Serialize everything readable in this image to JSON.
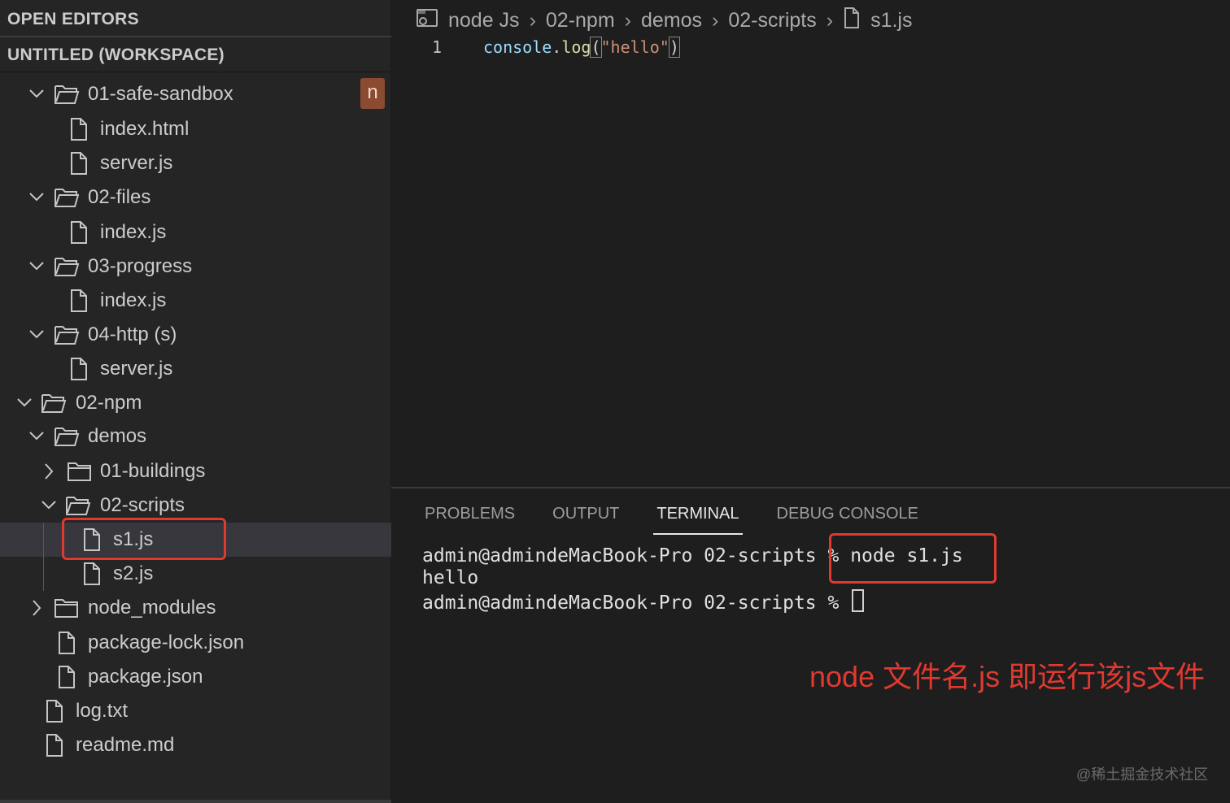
{
  "sidebar": {
    "open_editors_label": "OPEN EDITORS",
    "workspace_label": "UNTITLED (WORKSPACE)",
    "badge": "n",
    "tree": [
      {
        "label": "01-safe-sandbox",
        "kind": "folder",
        "expanded": true
      },
      {
        "label": "index.html",
        "kind": "file"
      },
      {
        "label": "server.js",
        "kind": "file"
      },
      {
        "label": "02-files",
        "kind": "folder",
        "expanded": true
      },
      {
        "label": "index.js",
        "kind": "file"
      },
      {
        "label": "03-progress",
        "kind": "folder",
        "expanded": true
      },
      {
        "label": "index.js",
        "kind": "file"
      },
      {
        "label": "04-http (s)",
        "kind": "folder",
        "expanded": true
      },
      {
        "label": "server.js",
        "kind": "file"
      },
      {
        "label": "02-npm",
        "kind": "folder",
        "expanded": true
      },
      {
        "label": "demos",
        "kind": "folder",
        "expanded": true
      },
      {
        "label": "01-buildings",
        "kind": "folder",
        "expanded": false
      },
      {
        "label": "02-scripts",
        "kind": "folder",
        "expanded": true
      },
      {
        "label": "s1.js",
        "kind": "file",
        "selected": true
      },
      {
        "label": "s2.js",
        "kind": "file"
      },
      {
        "label": "node_modules",
        "kind": "folder",
        "expanded": false
      },
      {
        "label": "package-lock.json",
        "kind": "file"
      },
      {
        "label": "package.json",
        "kind": "file"
      },
      {
        "label": "log.txt",
        "kind": "file"
      },
      {
        "label": "readme.md",
        "kind": "file"
      }
    ]
  },
  "editor": {
    "breadcrumb": [
      "node Js",
      "02-npm",
      "demos",
      "02-scripts",
      "s1.js"
    ],
    "line_number": "1",
    "code": {
      "object": "console",
      "dot": ".",
      "fn": "log",
      "open": "(",
      "string": "\"hello\"",
      "close": ")"
    }
  },
  "panel": {
    "tabs": [
      "PROBLEMS",
      "OUTPUT",
      "TERMINAL",
      "DEBUG CONSOLE"
    ],
    "active_tab": "TERMINAL",
    "terminal": {
      "prompt": "admin@admindeMacBook-Pro 02-scripts % ",
      "command": "node s1.js",
      "output": "hello",
      "prompt2": "admin@admindeMacBook-Pro 02-scripts % "
    },
    "annotation": "node 文件名.js 即运行该js文件",
    "watermark": "@稀土掘金技术社区"
  },
  "colors": {
    "highlight_box": "#e03a30",
    "badge_bg": "#8a4b30",
    "sidebar_bg": "#252526",
    "editor_bg": "#1e1e1e"
  }
}
